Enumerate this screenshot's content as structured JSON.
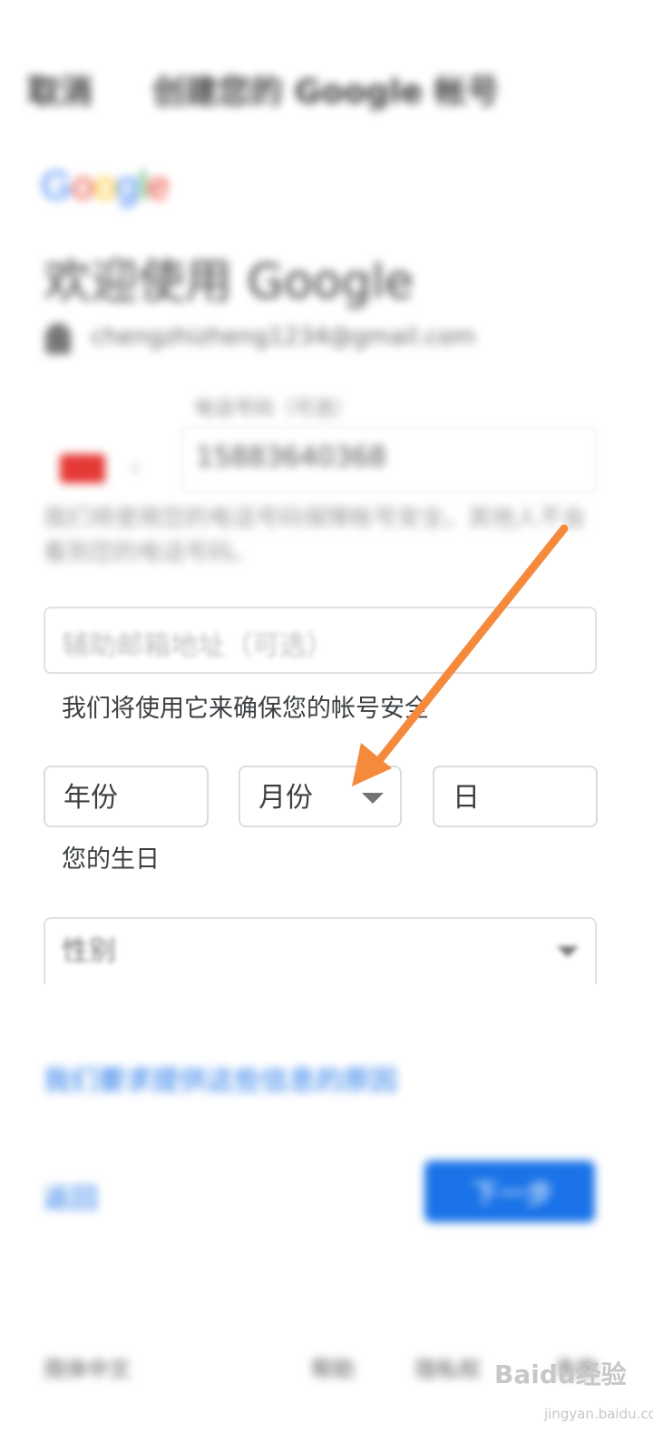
{
  "status_bar": {
    "left": "",
    "right": ""
  },
  "app_bar": {
    "cancel_label": "取消",
    "title": "创建您的 Google 帐号"
  },
  "logo": {
    "g1": "G",
    "o1": "o",
    "o2": "o",
    "g2": "g",
    "l": "l",
    "e": "e"
  },
  "welcome": "欢迎使用 Google",
  "account": {
    "email": "chengzhizheng1234@gmail.com"
  },
  "phone": {
    "label": "电话号码（可选）",
    "value": "15883640368",
    "help": "我们将使用您的电话号码保障帐号安全。其他人不会看到您的电话号码。"
  },
  "recovery_email": {
    "placeholder": "辅助邮箱地址（可选）",
    "help": "我们将使用它来确保您的帐号安全"
  },
  "birthday": {
    "year_placeholder": "年份",
    "month_placeholder": "月份",
    "day_placeholder": "日",
    "help": "您的生日"
  },
  "gender": {
    "placeholder": "性别"
  },
  "why_link": "我们要求提供这些信息的原因",
  "back_label": "返回",
  "next_label": "下一步",
  "footer": {
    "language": "简体中文",
    "help": "帮助",
    "privacy": "隐私权",
    "terms": "条款"
  },
  "watermark": {
    "brand": "Baidu经验",
    "url": "jingyan.baidu.com"
  },
  "colors": {
    "accent": "#1a73e8",
    "arrow": "#f58a3c"
  }
}
